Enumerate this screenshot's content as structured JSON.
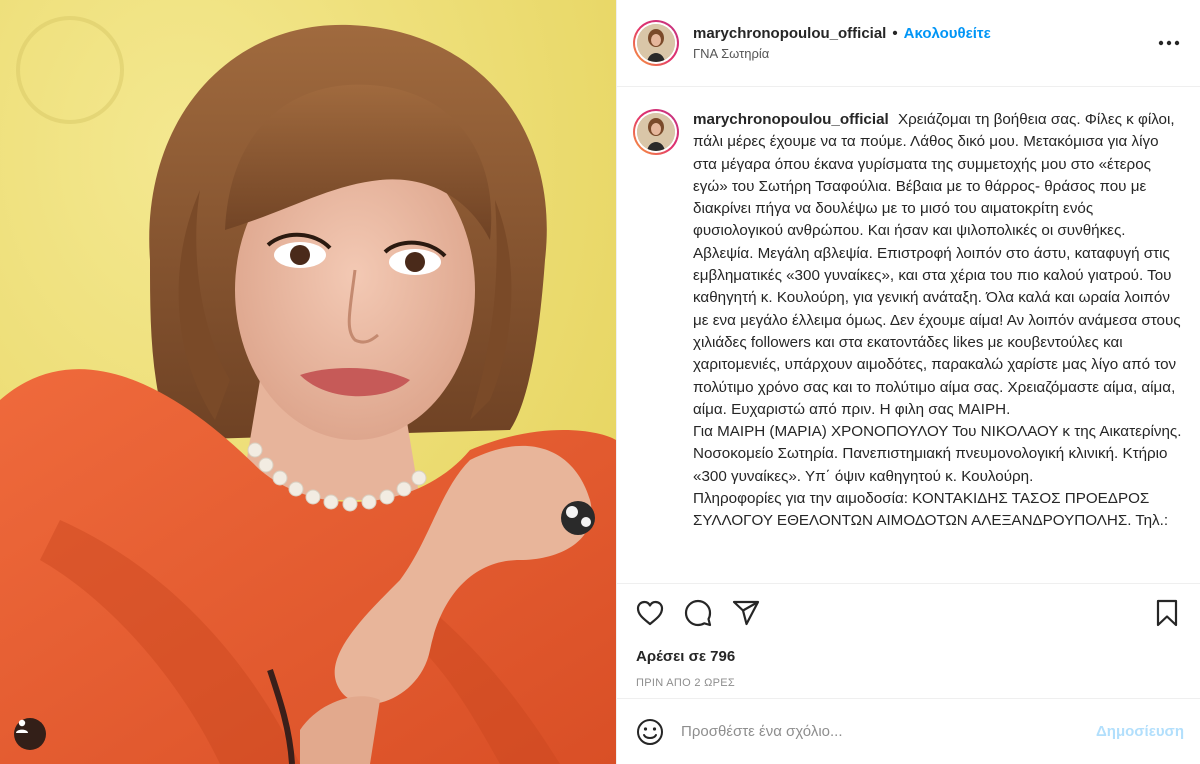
{
  "post": {
    "username": "marychronopoulou_official",
    "follow_label": "Ακολουθείτε",
    "separator": "•",
    "location": "ΓΝΑ Σωτηρία",
    "more_label": "•••",
    "caption_lines": [
      "Χρειάζομαι τη βοήθεια σας. Φίλες κ φίλοι, πάλι μέρες έχουμε να τα πούμε. Λάθος δικό μου. Μετακόμισα για λίγο στα μέγαρα όπου έκανα γυρίσματα της συμμετοχής μου στο «έτερος εγώ» του Σωτήρη Τσαφούλια. Βέβαια με το θάρρος- θράσος που με διακρίνει πήγα να δουλέψω με το μισό του αιματοκρίτη ενός φυσιολογικού ανθρώπου. Και ήσαν και ψιλοπολικές οι συνθήκες. Αβλεψία. Μεγάλη αβλεψία. Επιστροφή λοιπόν στο άστυ, καταφυγή στις εμβληματικές «300 γυναίκες», και στα χέρια του πιο καλού γιατρού. Του καθηγητή κ. Κουλούρη, για γενική ανάταξη. Όλα καλά και ωραία λοιπόν με ενα μεγάλο έλλειμα όμως. Δεν έχουμε αίμα! Αν λοιπόν ανάμεσα στους χιλιάδες followers και στα εκατοντάδες likes με κουβεντούλες και χαριτομενιές, υπάρχουν αιμοδότες, παρακαλώ χαρίστε μας λίγο από τον πολύτιμο χρόνο σας και το πολύτιμο αίμα σας. Χρειαζόμαστε αίμα, αίμα, αίμα. Ευχαριστώ από πριν. Η φιλη σας ΜΑΙΡΗ.",
      "Για ΜΑΙΡΗ (ΜΑΡΙΑ) ΧΡΟΝΟΠΟΥΛΟΥ Του ΝΙΚΟΛΑΟΥ κ της Αικατερίνης. Νοσοκομείο Σωτηρία. Πανεπιστημιακή πνευμονολογική κλινική. Κτήριο «300 γυναίκες». Υπ΄ όψιν καθηγητού κ. Κουλούρη.",
      "Πληροφορίες για την αιμοδοσία: ΚΟΝΤΑΚΙΔΗΣ ΤΑΣΟΣ ΠΡΟΕΔΡΟΣ ΣΥΛΛΟΓΟΥ ΕΘΕΛΟΝΤΩΝ ΑΙΜΟΔΟΤΩΝ ΑΛΕΞΑΝΔΡΟΥΠΟΛΗΣ. Τηλ.:"
    ],
    "likes": "Αρέσει σε 796",
    "time_ago": "ΠΡΙΝ ΑΠΟ 2 ΩΡΕΣ"
  },
  "comment": {
    "placeholder": "Προσθέστε ένα σχόλιο...",
    "post_label": "Δημοσίευση"
  },
  "icons": {
    "like": "heart-icon",
    "comment": "comment-bubble-icon",
    "share": "paper-plane-icon",
    "save": "bookmark-icon",
    "emoji": "smiley-icon",
    "more": "ellipsis-icon",
    "tagged": "user-tag-icon"
  },
  "colors": {
    "accent": "#0095f6",
    "post_disabled": "#b2dffc",
    "background_photo": "#eedc6e",
    "dress": "#e2582e",
    "hair": "#8a5530"
  }
}
